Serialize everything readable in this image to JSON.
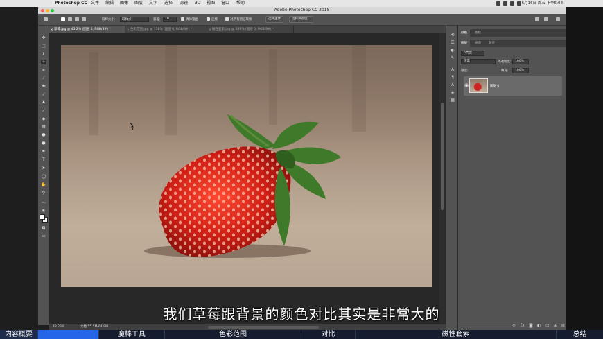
{
  "menubar": {
    "app_name": "Photoshop CC",
    "items": [
      "文件",
      "编辑",
      "图像",
      "图层",
      "文字",
      "选择",
      "滤镜",
      "3D",
      "视图",
      "窗口",
      "帮助"
    ],
    "clock": "6月16日 周五 下午5:08"
  },
  "window": {
    "title": "Adobe Photoshop CC 2018"
  },
  "options": {
    "sample_size_label": "取样大小:",
    "sample_size_value": "取样点",
    "tolerance_label": "容差:",
    "tolerance_value": "10",
    "antialias_label": "消除锯齿",
    "contiguous_label": "连续",
    "sample_all_label": "对所有图层取样",
    "select_subject_label": "选择主体",
    "select_mask_label": "选择并遮住..."
  },
  "tabs": [
    {
      "label": "草莓.jpg @ 43.2% (图层 0, RGB/8#) *",
      "active": true
    },
    {
      "label": "色彩范围.jpg @ 138% (图层 0, RGB/8#) *",
      "active": false
    },
    {
      "label": "磁性套索.jpg @ 249% (图层 0, RGB/8#) *",
      "active": false
    }
  ],
  "tools": [
    "move",
    "marquee",
    "lasso",
    "magic-wand",
    "crop",
    "eyedropper",
    "healing",
    "brush",
    "stamp",
    "history-brush",
    "eraser",
    "gradient",
    "blur",
    "dodge",
    "pen",
    "type",
    "path-select",
    "shape",
    "hand",
    "zoom",
    "more"
  ],
  "status": {
    "zoom": "43.23%",
    "doc": "文档:55.5M/64.9M"
  },
  "panels": {
    "top_tabs": [
      "颜色",
      "色板"
    ],
    "layer_tabs": [
      "图层",
      "通道",
      "路径"
    ],
    "filter_kind": "ρ类型",
    "blend_mode": "正常",
    "opacity_label": "不透明度:",
    "opacity_value": "100%",
    "lock_label": "锁定:",
    "fill_label": "填充:",
    "fill_value": "100%",
    "layer_name": "图层 0"
  },
  "subtitle": "我们草莓跟背景的颜色对比其实是非常大的",
  "chapters": [
    {
      "label": "内容概要"
    },
    {
      "label": "魔棒工具"
    },
    {
      "label": "色彩范围"
    },
    {
      "label": "对比"
    },
    {
      "label": "磁性套索"
    },
    {
      "label": "总结"
    }
  ],
  "colors": {
    "ui_bg": "#535353",
    "workspace": "#282828",
    "progress": "#2566e8",
    "strawberry": "#d11f16",
    "leaf": "#3f7a2a"
  }
}
